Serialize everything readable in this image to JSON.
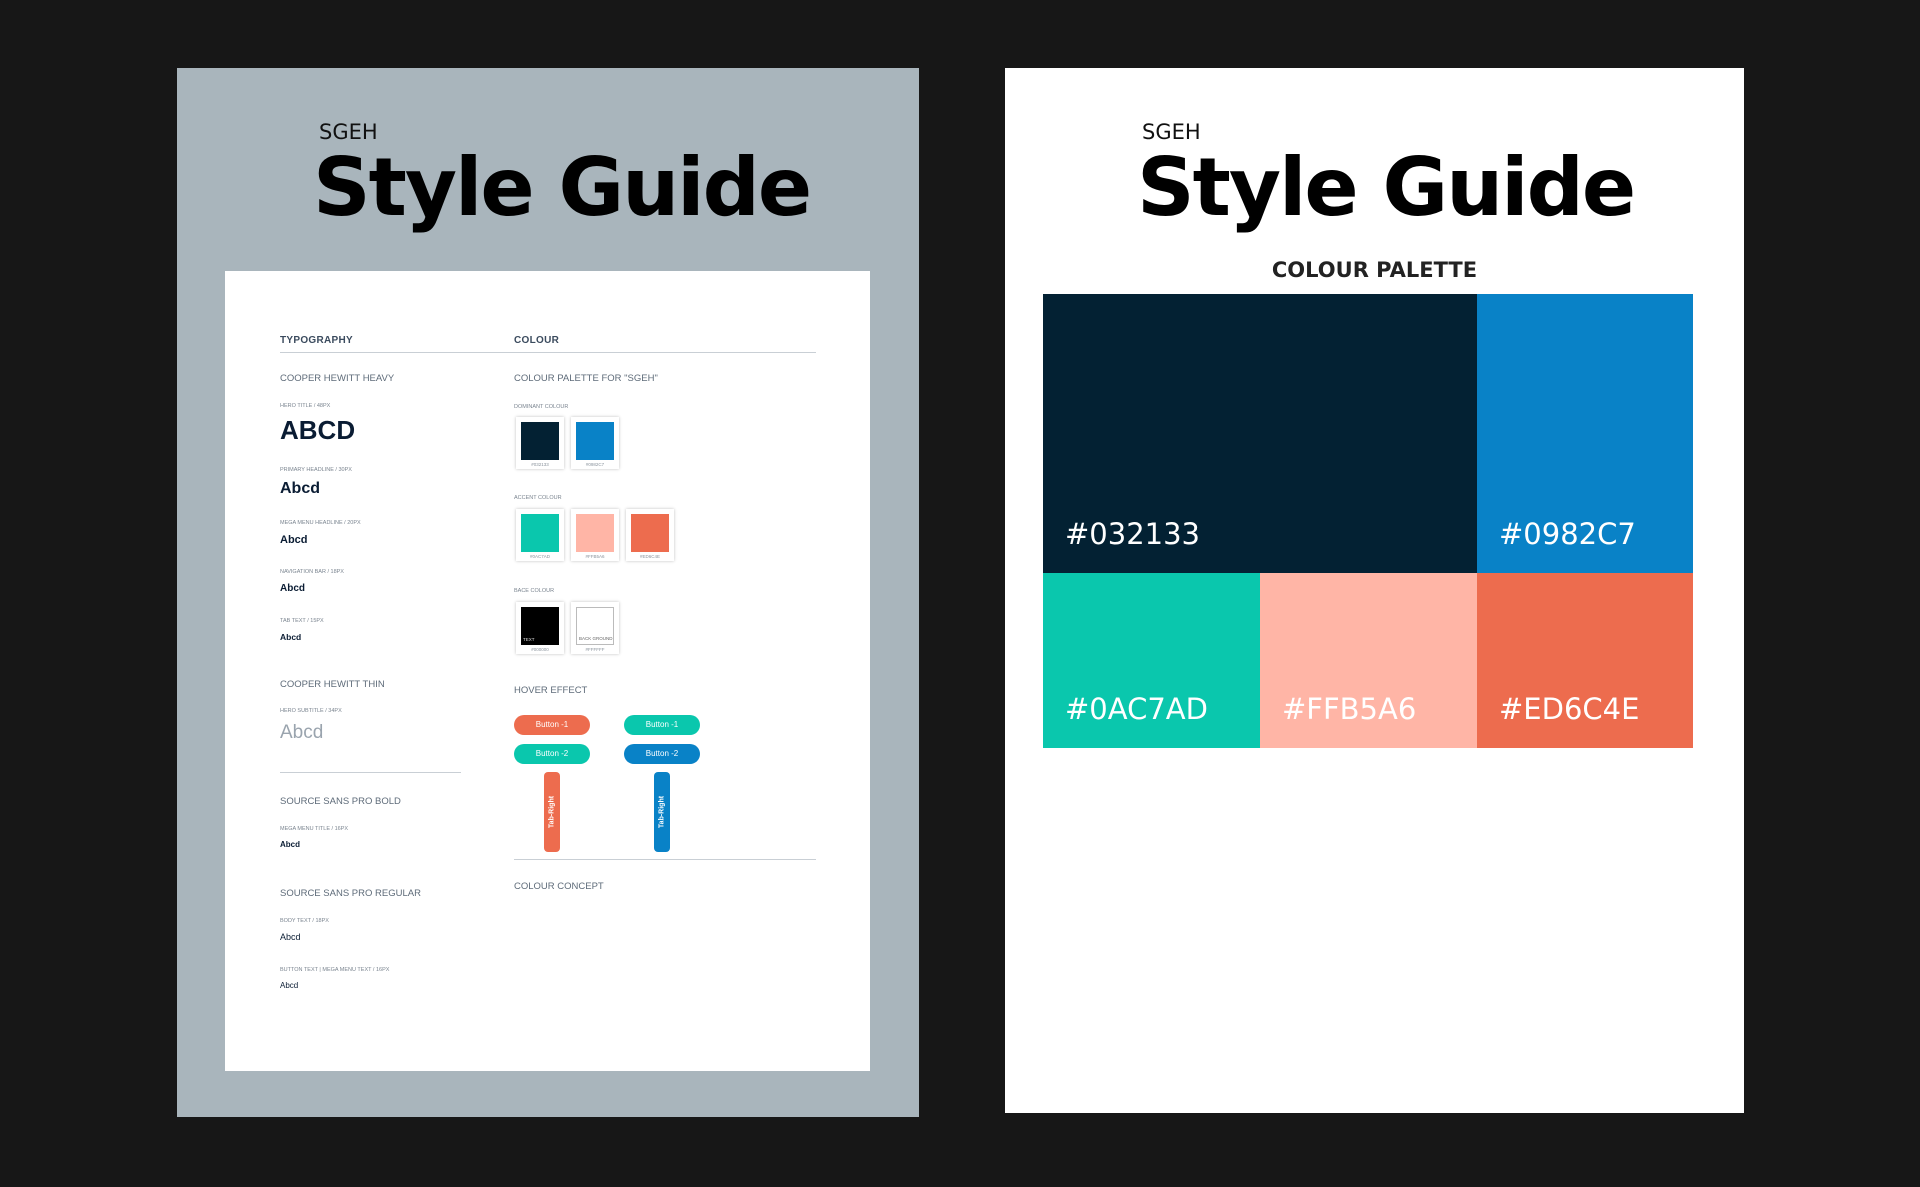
{
  "left_board": {
    "brand": "SGEH",
    "title": "Style Guide",
    "typography": {
      "heading": "TYPOGRAPHY",
      "cooper_heavy": {
        "title": "COOPER HEWITT HEAVY",
        "samples": [
          {
            "meta": "HERO TITLE / 48PX",
            "text": "ABCD"
          },
          {
            "meta": "PRIMARY HEADLINE / 30PX",
            "text": "Abcd"
          },
          {
            "meta": "MEGA MENU HEADLINE / 20PX",
            "text": "Abcd"
          },
          {
            "meta": "NAVIGATION BAR / 18PX",
            "text": "Abcd"
          },
          {
            "meta": "TAB TEXT / 15PX",
            "text": "Abcd"
          }
        ]
      },
      "cooper_thin": {
        "title": "COOPER HEWITT THIN",
        "meta": "HERO SUBTITLE / 34PX",
        "text": "Abcd"
      },
      "source_bold": {
        "title": "SOURCE SANS PRO BOLD",
        "meta": "MEGA MENU TITLE / 16PX",
        "text": "Abcd"
      },
      "source_regular": {
        "title": "SOURCE SANS PRO REGULAR",
        "samples": [
          {
            "meta": "BODY TEXT / 18PX",
            "text": "Abcd"
          },
          {
            "meta": "BUTTON TEXT | MEGA MENU TEXT / 16PX",
            "text": "Abcd"
          }
        ]
      }
    },
    "colour": {
      "heading": "COLOUR",
      "palette_title": "COLOUR PALETTE FOR \"SGEH\"",
      "dominant": {
        "label": "DOMINANT COLOUR",
        "swatches": [
          {
            "color": "#032133",
            "caption": "#032133"
          },
          {
            "color": "#0982C7",
            "caption": "#0982C7"
          }
        ]
      },
      "accent": {
        "label": "ACCENT COLOUR",
        "swatches": [
          {
            "color": "#0AC7AD",
            "caption": "#0AC7AD"
          },
          {
            "color": "#FFB5A6",
            "caption": "#FFB5A6"
          },
          {
            "color": "#ED6C4E",
            "caption": "#ED6C4E"
          }
        ]
      },
      "base": {
        "label": "BACE COLOUR",
        "swatches": [
          {
            "color": "#000000",
            "caption": "#000000",
            "inner": "TEXT"
          },
          {
            "color": "#FFFFFF",
            "caption": "#FFFFFF",
            "inner": "BACK GROUND"
          }
        ]
      },
      "hover": {
        "label": "HOVER EFFECT",
        "button1": "Button -1",
        "button2": "Button -2",
        "tab": "Tab-Right",
        "colors": {
          "coral": "#ED6C4E",
          "teal": "#0AC7AD",
          "blue": "#0982C7"
        }
      },
      "concept": "COLOUR CONCEPT"
    }
  },
  "right_board": {
    "brand": "SGEH",
    "title": "Style Guide",
    "palette_heading": "COLOUR PALETTE",
    "blocks": [
      {
        "color": "#032133",
        "label": "#032133"
      },
      {
        "color": "#0982C7",
        "label": "#0982C7"
      },
      {
        "color": "#0AC7AD",
        "label": "#0AC7AD"
      },
      {
        "color": "#FFB5A6",
        "label": "#FFB5A6"
      },
      {
        "color": "#ED6C4E",
        "label": "#ED6C4E"
      }
    ]
  }
}
